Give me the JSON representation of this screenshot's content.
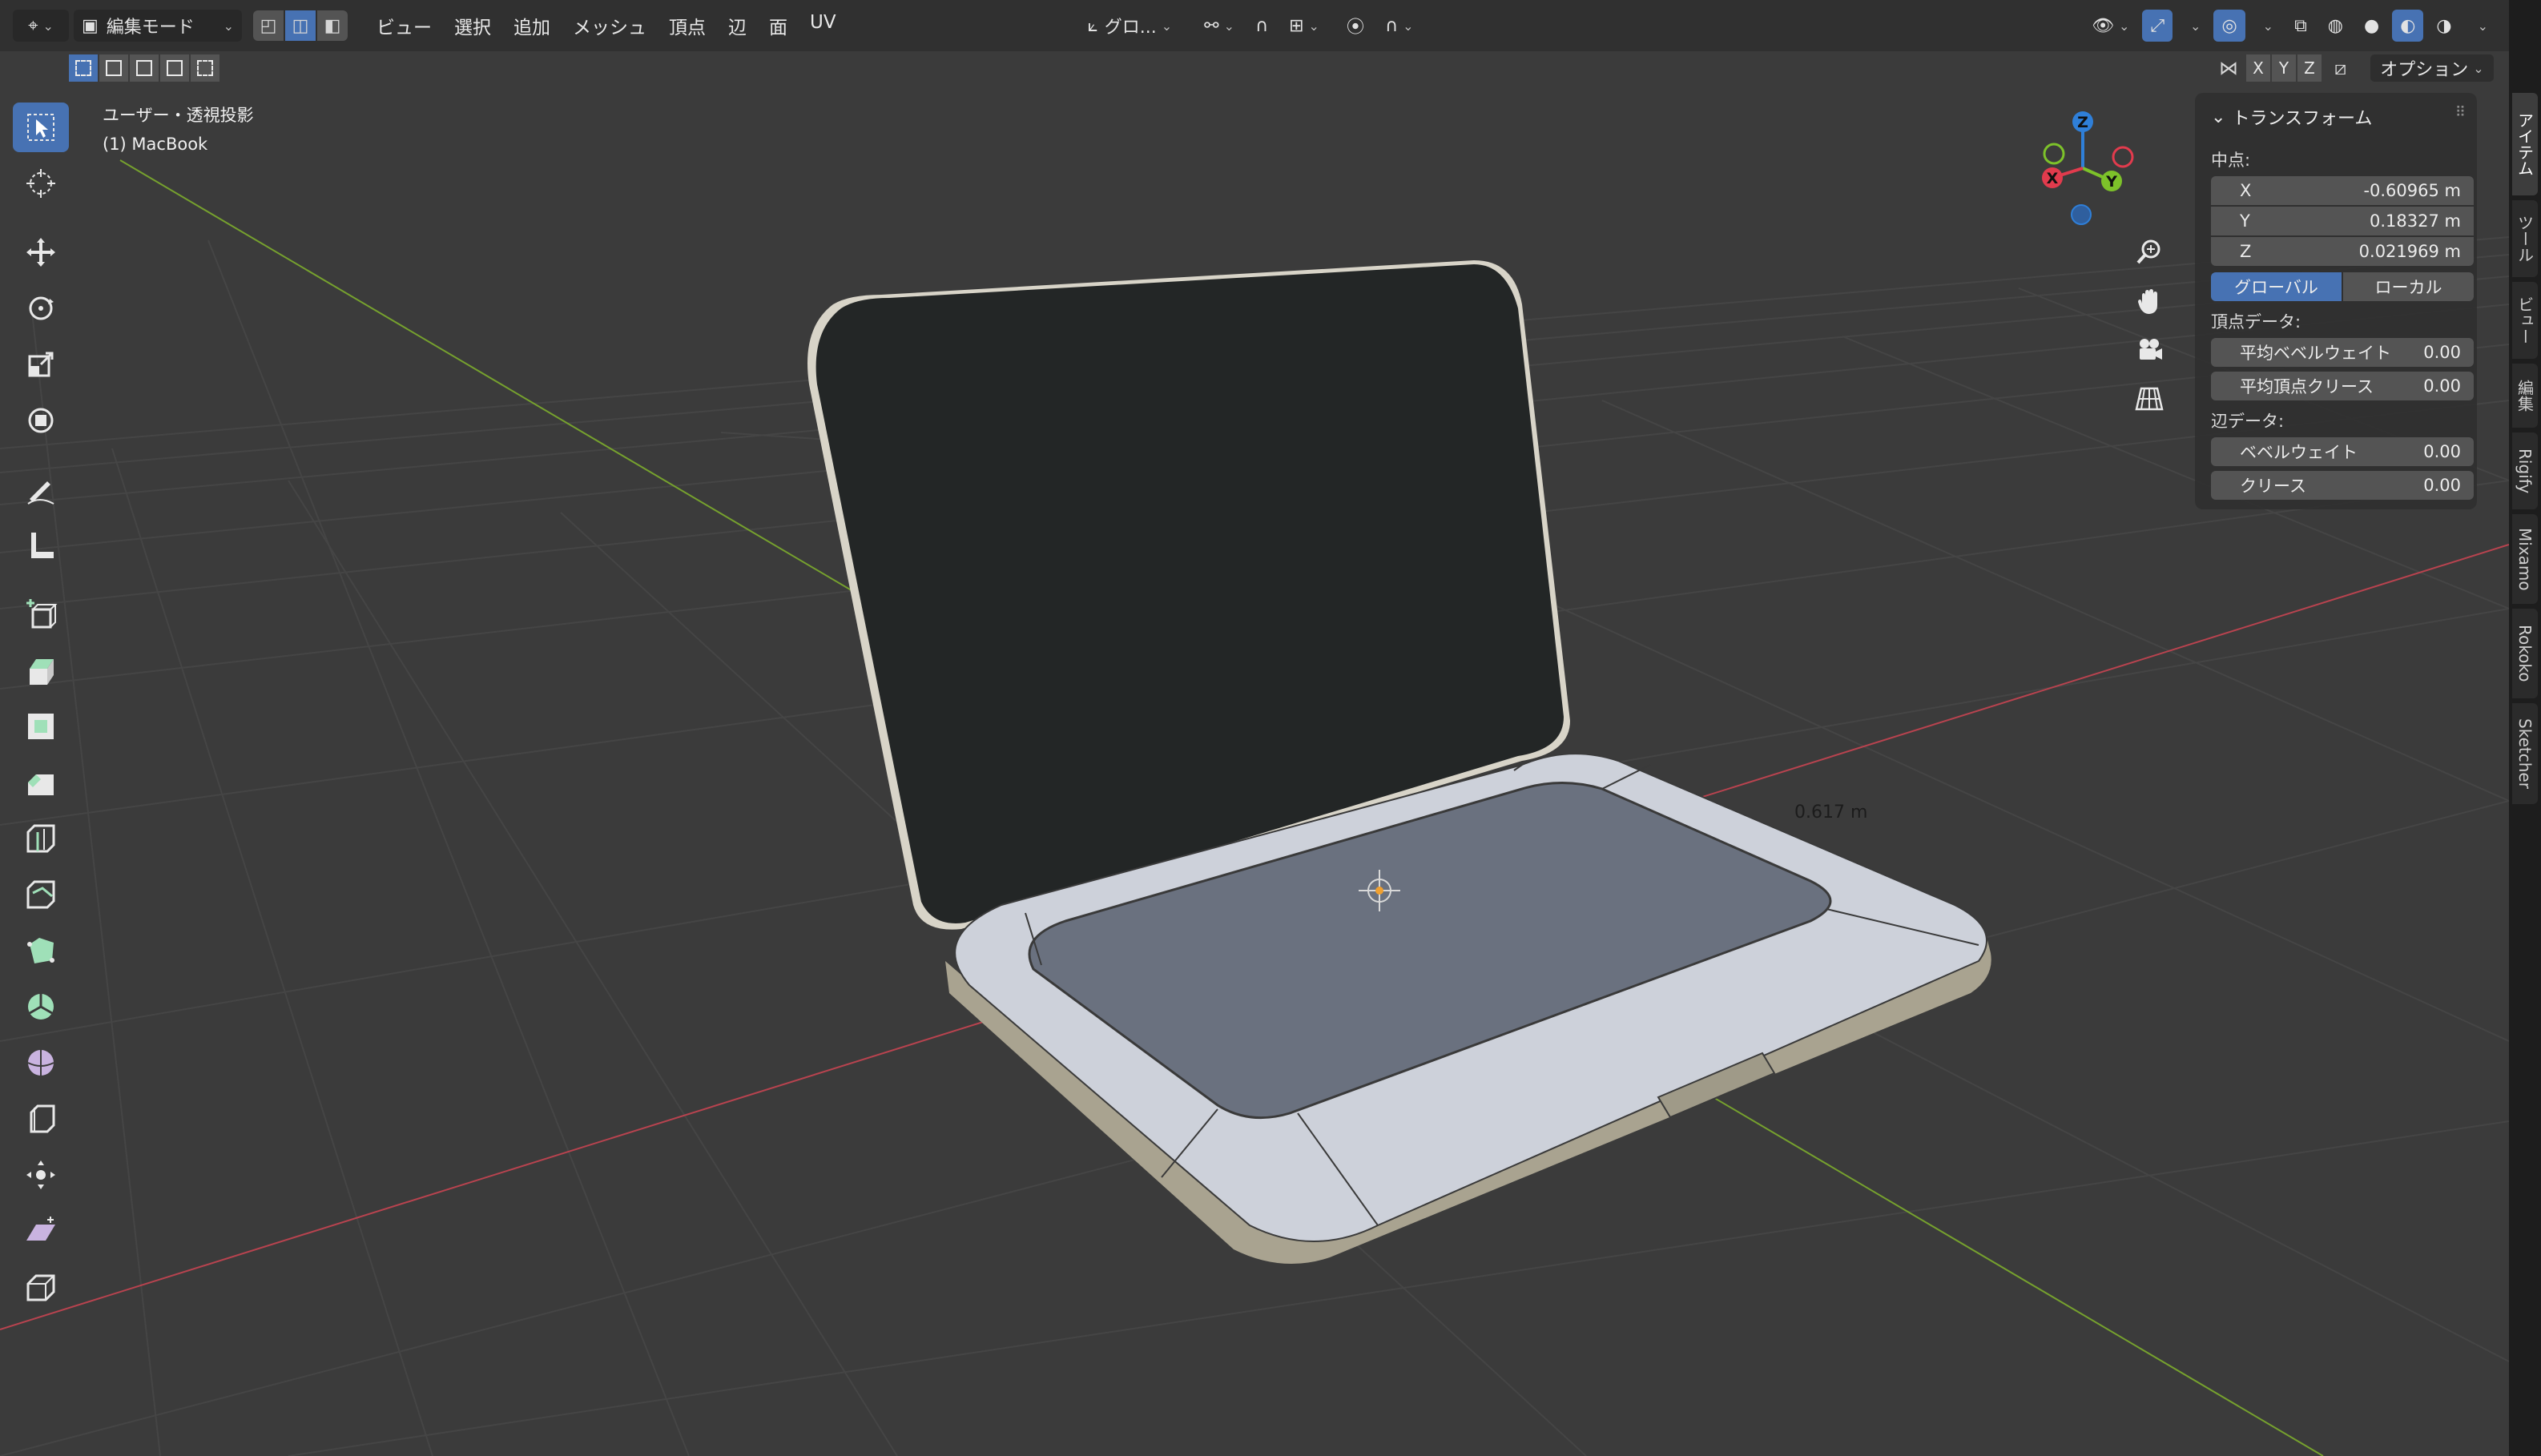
{
  "header": {
    "mode_label": "編集モード",
    "menus": [
      "ビュー",
      "選択",
      "追加",
      "メッシュ",
      "頂点",
      "辺",
      "面",
      "UV"
    ],
    "transform_orientation": "グロ..."
  },
  "subheader": {
    "axes": [
      "X",
      "Y",
      "Z"
    ],
    "options_label": "オプション"
  },
  "view_info": {
    "projection": "ユーザー・透視投影",
    "object": "(1) MacBook"
  },
  "viewport": {
    "dimension_label": "0.617 m"
  },
  "gizmo": {
    "x": "X",
    "y": "Y",
    "z": "Z",
    "colors": {
      "x": "#e23b4d",
      "y": "#7dc22a",
      "z": "#2f7fd8"
    }
  },
  "npanel": {
    "title": "トランスフォーム",
    "median_label": "中点:",
    "x_label": "X",
    "x_value": "-0.60965 m",
    "y_label": "Y",
    "y_value": "0.18327 m",
    "z_label": "Z",
    "z_value": "0.021969 m",
    "global_label": "グローバル",
    "local_label": "ローカル",
    "vertex_data_label": "頂点データ:",
    "mean_bevel_weight_label": "平均ベベルウェイト",
    "mean_bevel_weight_value": "0.00",
    "mean_vertex_crease_label": "平均頂点クリース",
    "mean_vertex_crease_value": "0.00",
    "edge_data_label": "辺データ:",
    "bevel_weight_label": "ベベルウェイト",
    "bevel_weight_value": "0.00",
    "crease_label": "クリース",
    "crease_value": "0.00"
  },
  "tabs": [
    "アイテム",
    "ツール",
    "ビュー",
    "編集",
    "Rigify",
    "Mixamo",
    "Rokoko",
    "Sketcher"
  ],
  "colors": {
    "accent": "#4772b3",
    "background": "#3a3a3a",
    "panel": "#303030"
  }
}
